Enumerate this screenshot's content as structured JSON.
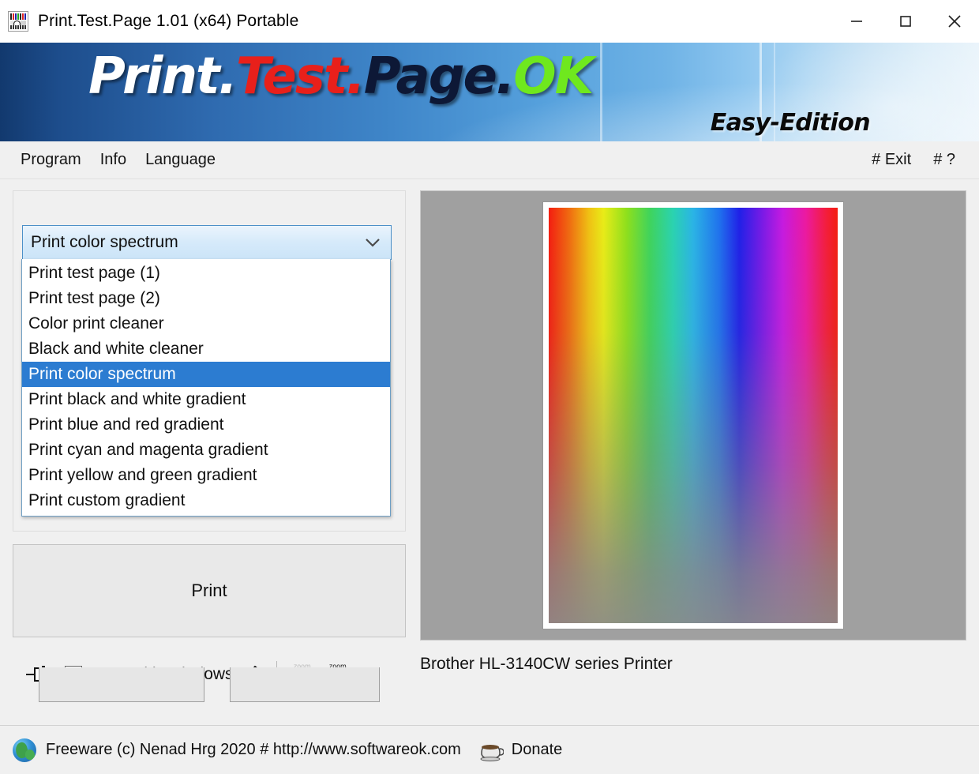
{
  "titlebar": {
    "title": "Print.Test.Page 1.01  (x64) Portable",
    "app_icon": "print-test-page-icon",
    "minimize": "minimize-icon",
    "maximize": "maximize-icon",
    "close": "close-icon"
  },
  "banner": {
    "logo_part1": "Print.",
    "logo_part2": "Test.",
    "logo_part3": "Page.",
    "logo_part4": "OK",
    "edition": "Easy-Edition",
    "colors": {
      "part1": "#ffffff",
      "part2": "#e8201b",
      "part3": "#0d1836",
      "part4": "#6fe81e",
      "bg_left": "#12396e",
      "bg_right": "#eaf4fb"
    }
  },
  "menubar": {
    "items": [
      {
        "label": "Program"
      },
      {
        "label": "Info"
      },
      {
        "label": "Language"
      }
    ],
    "right_items": [
      {
        "label": "# Exit"
      },
      {
        "label": "# ?"
      }
    ]
  },
  "left_panel": {
    "combo": {
      "selected_value": "Print color spectrum",
      "arrow_icon": "chevron-down-icon",
      "expanded": true,
      "options": [
        "Print test page (1)",
        "Print test page (2)",
        "Color print cleaner",
        "Black and white cleaner",
        "Print color spectrum",
        "Print black and white gradient",
        "Print blue and red gradient",
        "Print cyan and magenta gradient",
        "Print yellow and green gradient",
        "Print custom gradient"
      ],
      "selected_index": 4,
      "highlight_color": "#2c7cd1"
    },
    "print_button": {
      "label": "Print"
    },
    "toolbar": {
      "pin_icon": "pin-icon",
      "startup_checkbox": {
        "label": "Start with Windows",
        "checked": false
      },
      "edit_icon": "pencil-edit-icon",
      "zoom_out_icon": "zoom-out-icon",
      "zoom_in_icon": "zoom-in-icon"
    }
  },
  "preview": {
    "printer_name": "Brother HL-3140CW series Printer",
    "background_color": "#a0a0a0",
    "paper_color": "#ffffff",
    "page_type": "color-spectrum"
  },
  "statusbar": {
    "globe_icon": "globe-icon",
    "text": "Freeware (c) Nenad Hrg 2020 # http://www.softwareok.com",
    "coffee_icon": "coffee-cup-icon",
    "donate_label": "Donate"
  }
}
